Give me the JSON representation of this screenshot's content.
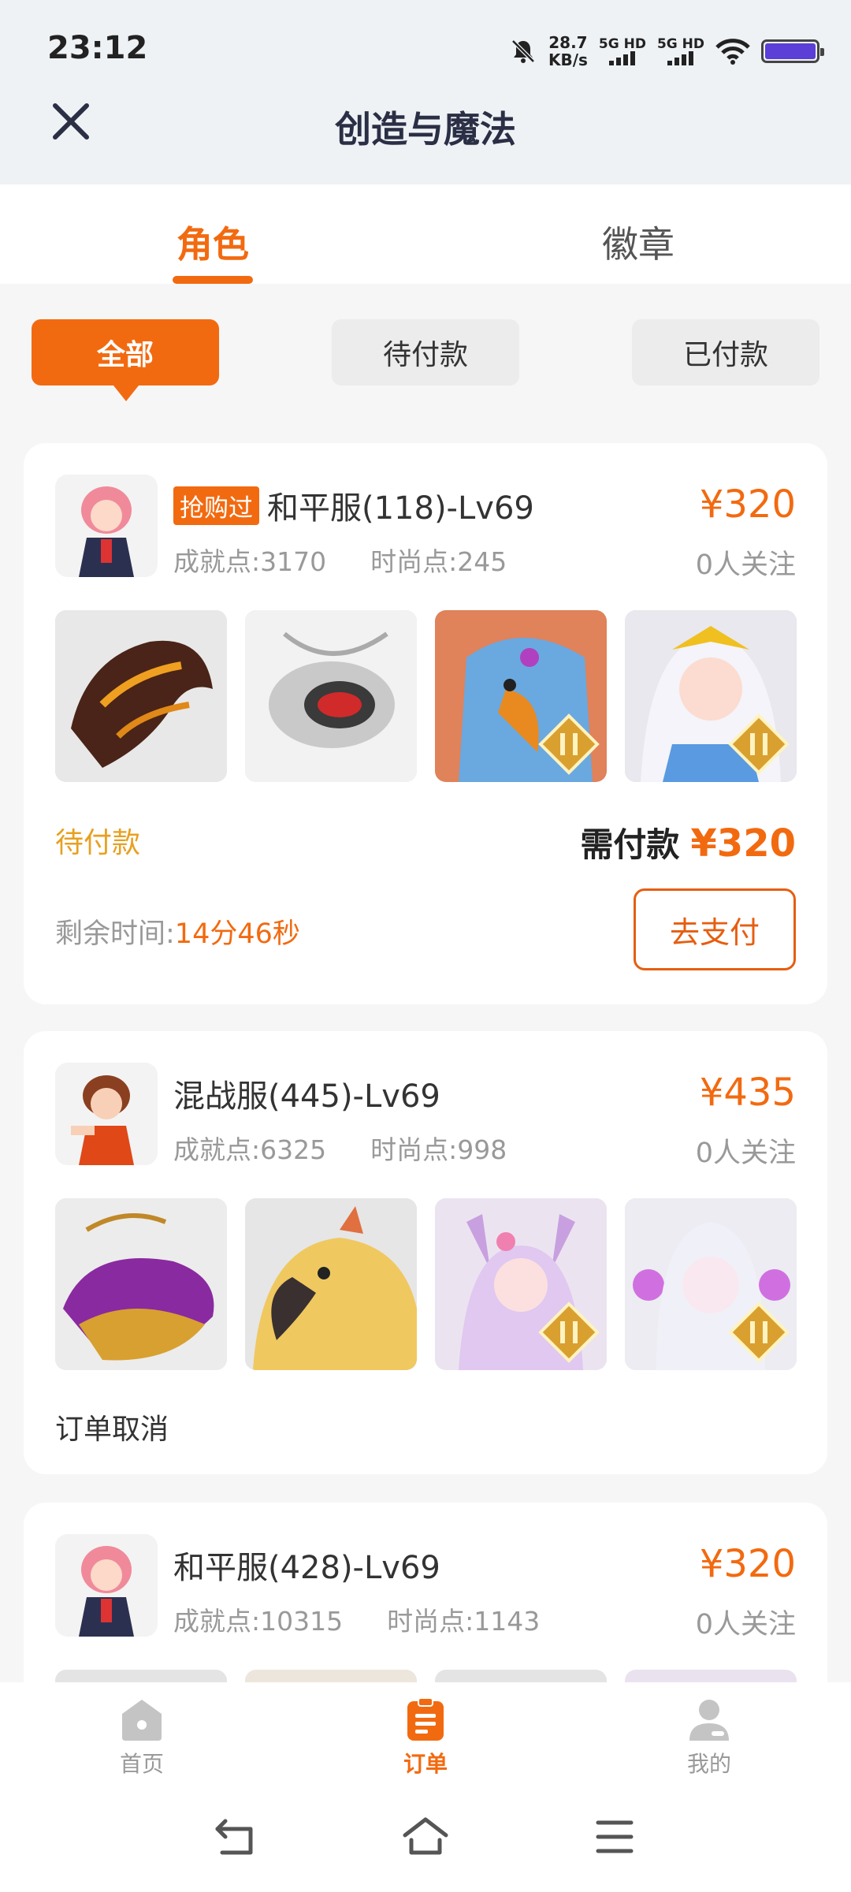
{
  "status_bar": {
    "time": "23:12",
    "net_speed_value": "28.7",
    "net_speed_unit": "KB/s",
    "sim1": "5G HD",
    "sim2": "5G HD"
  },
  "header": {
    "title": "创造与魔法"
  },
  "tabs": [
    {
      "label": "角色",
      "active": true
    },
    {
      "label": "徽章",
      "active": false
    }
  ],
  "filters": [
    {
      "label": "全部",
      "active": true
    },
    {
      "label": "待付款",
      "active": false
    },
    {
      "label": "已付款",
      "active": false
    }
  ],
  "orders": [
    {
      "badge": "抢购过",
      "name": "和平服(118)-Lv69",
      "achievement": "成就点:3170",
      "fashion": "时尚点:245",
      "price": "¥320",
      "followers": "0人关注",
      "status": "待付款",
      "pay_label": "需付款",
      "pay_amount": "¥320",
      "remain_label": "剩余时间:",
      "remain_value": "14分46秒",
      "pay_button": "去支付",
      "thumbs": [
        "dark-dragon-mount",
        "silver-beetle-mount",
        "blue-eagle-pet",
        "white-hair-character"
      ]
    },
    {
      "name": "混战服(445)-Lv69",
      "achievement": "成就点:6325",
      "fashion": "时尚点:998",
      "price": "¥435",
      "followers": "0人关注",
      "status": "订单取消",
      "thumbs": [
        "purple-whale-mount",
        "yellow-parrot-pet",
        "pink-fox-character",
        "white-doll-character"
      ]
    },
    {
      "name": "和平服(428)-Lv69",
      "achievement": "成就点:10315",
      "fashion": "时尚点:1143",
      "price": "¥320",
      "followers": "0人关注"
    }
  ],
  "bottom_nav": [
    {
      "label": "首页",
      "icon": "home-icon"
    },
    {
      "label": "订单",
      "icon": "order-icon",
      "active": true
    },
    {
      "label": "我的",
      "icon": "profile-icon"
    }
  ],
  "colors": {
    "accent": "#f26a10",
    "header_bg": "#eef2f5",
    "page_bg": "#f6f6f6"
  }
}
